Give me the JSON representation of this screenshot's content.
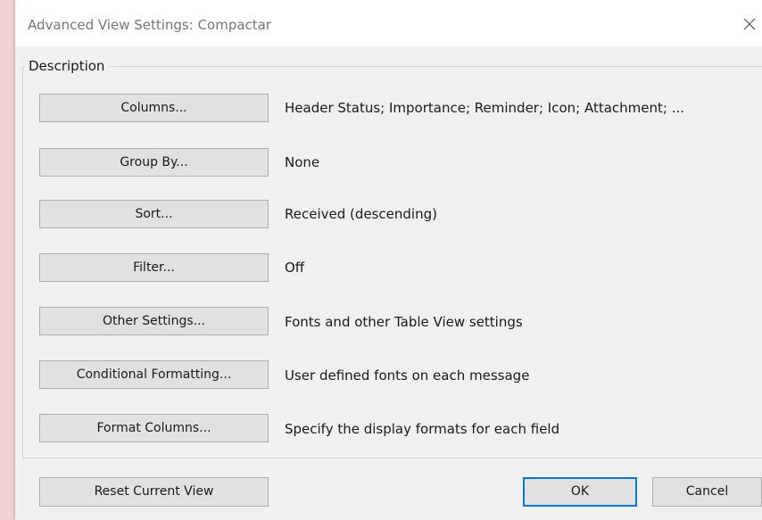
{
  "window": {
    "title": "Advanced View Settings: Compactar",
    "close_icon": "close-icon"
  },
  "description_group": {
    "label": "Description",
    "rows": [
      {
        "button_label": "Columns...",
        "value": "Header Status; Importance; Reminder; Icon; Attachment; ..."
      },
      {
        "button_label": "Group By...",
        "value": "None"
      },
      {
        "button_label": "Sort...",
        "value": "Received (descending)"
      },
      {
        "button_label": "Filter...",
        "value": "Off"
      },
      {
        "button_label": "Other Settings...",
        "value": "Fonts and other Table View settings"
      },
      {
        "button_label": "Conditional Formatting...",
        "value": "User defined fonts on each message"
      },
      {
        "button_label": "Format Columns...",
        "value": "Specify the display formats for each field"
      }
    ]
  },
  "footer": {
    "reset_label": "Reset Current View",
    "ok_label": "OK",
    "cancel_label": "Cancel"
  },
  "colors": {
    "backdrop": "#f3d2d2",
    "dialog_bg": "#f0f0f0",
    "button_bg": "#e1e1e1",
    "button_border": "#adadad",
    "focus_border": "#0078d7"
  }
}
